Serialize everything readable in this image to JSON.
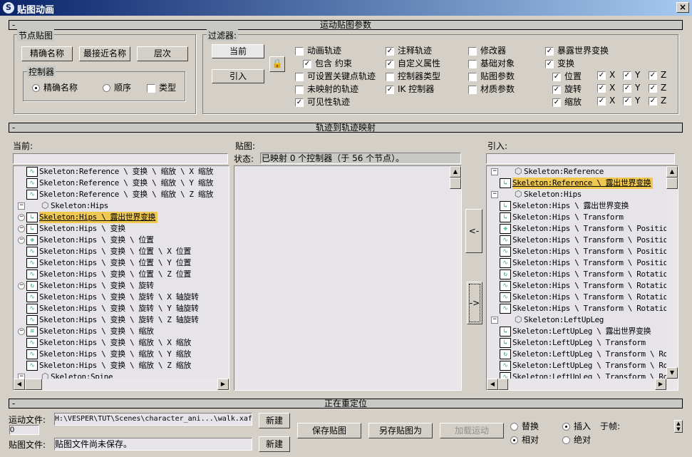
{
  "window": {
    "title": "贴图动画",
    "close": "×"
  },
  "rollouts": {
    "params": "运动贴图参数",
    "track_map": "轨迹到轨迹映射",
    "retarget": "正在重定位",
    "collapse": "-"
  },
  "node_map": {
    "label": "节点贴图",
    "exact": "精确名称",
    "closest": "最接近名称",
    "hierarchy": "层次",
    "controllers": {
      "label": "控制器",
      "exact": "精确名称",
      "order": "顺序",
      "type": "类型",
      "selected": "exact",
      "type_checked": false
    }
  },
  "filters": {
    "label": "过滤器:",
    "current": "当前",
    "incoming": "引入",
    "col1": [
      {
        "label": "动画轨迹",
        "checked": false
      },
      {
        "label": "包含 约束",
        "checked": true,
        "indent": true
      },
      {
        "label": "可设置关键点轨迹",
        "checked": false
      },
      {
        "label": "未映射的轨迹",
        "checked": false
      },
      {
        "label": "可见性轨迹",
        "checked": true
      }
    ],
    "col2": [
      {
        "label": "注释轨迹",
        "checked": true
      },
      {
        "label": "自定义属性",
        "checked": true
      },
      {
        "label": "控制器类型",
        "checked": false
      },
      {
        "label": "IK 控制器",
        "checked": true
      }
    ],
    "col3": [
      {
        "label": "修改器",
        "checked": false
      },
      {
        "label": "基础对象",
        "checked": false
      },
      {
        "label": "贴图参数",
        "checked": false
      },
      {
        "label": "材质参数",
        "checked": false
      }
    ],
    "col4": [
      {
        "label": "暴露世界变换",
        "checked": true
      },
      {
        "label": "变换",
        "checked": true
      }
    ],
    "axes": [
      {
        "label": "位置",
        "checked": true
      },
      {
        "label": "旋转",
        "checked": true
      },
      {
        "label": "缩放",
        "checked": true
      }
    ],
    "axis_names": [
      "X",
      "Y",
      "Z"
    ]
  },
  "current": {
    "label": "当前:",
    "filter": "",
    "items": [
      {
        "text": "Skeleton:Reference \\ 变换 \\ 缩放 \\ X 缩放",
        "icon": "wave"
      },
      {
        "text": "Skeleton:Reference \\ 变换 \\ 缩放 \\ Y 缩放",
        "icon": "wave"
      },
      {
        "text": "Skeleton:Reference \\ 变换 \\ 缩放 \\ Z 缩放",
        "icon": "wave"
      },
      {
        "text": "Skeleton:Hips",
        "icon": "cube",
        "exp": "box"
      },
      {
        "text": "Skeleton:Hips \\ 露出世界变换",
        "icon": "xyz",
        "exp": "circle",
        "selected": true
      },
      {
        "text": "Skeleton:Hips \\ 变换",
        "icon": "xyz",
        "exp": "circle"
      },
      {
        "text": "Skeleton:Hips \\ 变换 \\ 位置",
        "icon": "move",
        "exp": "circle"
      },
      {
        "text": "Skeleton:Hips \\ 变换 \\ 位置 \\ X 位置",
        "icon": "wave"
      },
      {
        "text": "Skeleton:Hips \\ 变换 \\ 位置 \\ Y 位置",
        "icon": "wave"
      },
      {
        "text": "Skeleton:Hips \\ 变换 \\ 位置 \\ Z 位置",
        "icon": "wave"
      },
      {
        "text": "Skeleton:Hips \\ 变换 \\ 旋转",
        "icon": "rotate",
        "exp": "circle"
      },
      {
        "text": "Skeleton:Hips \\ 变换 \\ 旋转 \\ X 轴旋转",
        "icon": "wave"
      },
      {
        "text": "Skeleton:Hips \\ 变换 \\ 旋转 \\ Y 轴旋转",
        "icon": "wave"
      },
      {
        "text": "Skeleton:Hips \\ 变换 \\ 旋转 \\ Z 轴旋转",
        "icon": "wave"
      },
      {
        "text": "Skeleton:Hips \\ 变换 \\ 缩放",
        "icon": "scale",
        "exp": "circle"
      },
      {
        "text": "Skeleton:Hips \\ 变换 \\ 缩放 \\ X 缩放",
        "icon": "wave"
      },
      {
        "text": "Skeleton:Hips \\ 变换 \\ 缩放 \\ Y 缩放",
        "icon": "wave"
      },
      {
        "text": "Skeleton:Hips \\ 变换 \\ 缩放 \\ Z 缩放",
        "icon": "wave"
      },
      {
        "text": "Skeleton:Spine",
        "icon": "cube",
        "exp": "box"
      }
    ]
  },
  "mapping": {
    "label": "贴图:",
    "status_label": "状态:",
    "status": "已映射 0 个控制器（于 56 个节点）。",
    "left_arrow": "<-",
    "right_arrow": "->"
  },
  "incoming": {
    "label": "引入:",
    "filter": "",
    "items": [
      {
        "text": "Skeleton:Reference",
        "icon": "cube",
        "exp": "box"
      },
      {
        "text": "Skeleton:Reference \\ 露出世界变换",
        "icon": "xyz",
        "selected": true
      },
      {
        "text": "Skeleton:Hips",
        "icon": "cube",
        "exp": "box"
      },
      {
        "text": "Skeleton:Hips \\ 露出世界变换",
        "icon": "xyz"
      },
      {
        "text": "Skeleton:Hips \\ Transform",
        "icon": "xyz"
      },
      {
        "text": "Skeleton:Hips \\ Transform \\ Position",
        "icon": "move"
      },
      {
        "text": "Skeleton:Hips \\ Transform \\ Position",
        "icon": "wave"
      },
      {
        "text": "Skeleton:Hips \\ Transform \\ Position",
        "icon": "wave"
      },
      {
        "text": "Skeleton:Hips \\ Transform \\ Position",
        "icon": "wave"
      },
      {
        "text": "Skeleton:Hips \\ Transform \\ Rotation",
        "icon": "rotate"
      },
      {
        "text": "Skeleton:Hips \\ Transform \\ Rotation",
        "icon": "wave"
      },
      {
        "text": "Skeleton:Hips \\ Transform \\ Rotation",
        "icon": "wave"
      },
      {
        "text": "Skeleton:Hips \\ Transform \\ Rotation",
        "icon": "wave"
      },
      {
        "text": "Skeleton:LeftUpLeg",
        "icon": "cube",
        "exp": "box"
      },
      {
        "text": "Skeleton:LeftUpLeg \\ 露出世界变换",
        "icon": "xyz"
      },
      {
        "text": "Skeleton:LeftUpLeg \\ Transform",
        "icon": "xyz"
      },
      {
        "text": "Skeleton:LeftUpLeg \\ Transform \\ Rot",
        "icon": "rotate"
      },
      {
        "text": "Skeleton:LeftUpLeg \\ Transform \\ Rot",
        "icon": "wave"
      },
      {
        "text": "Skeleton:LeftUpLeg \\ Transform \\ Rot",
        "icon": "wave"
      }
    ]
  },
  "retarget": {
    "motion_file_label": "运动文件:",
    "motion_file": "H:\\VESPER\\TUT\\Scenes\\character_ani...\\walk.xaf",
    "frame": "0",
    "map_file_label": "贴图文件:",
    "map_file": "贴图文件尚未保存。",
    "new": "新建",
    "save_map": "保存贴图",
    "save_map_as": "另存贴图为",
    "load_motion": "加载运动",
    "replace": "替换",
    "insert": "插入",
    "relative": "相对",
    "absolute": "绝对",
    "at_frame": "于帧:",
    "mode": "insert",
    "offset": "relative"
  }
}
